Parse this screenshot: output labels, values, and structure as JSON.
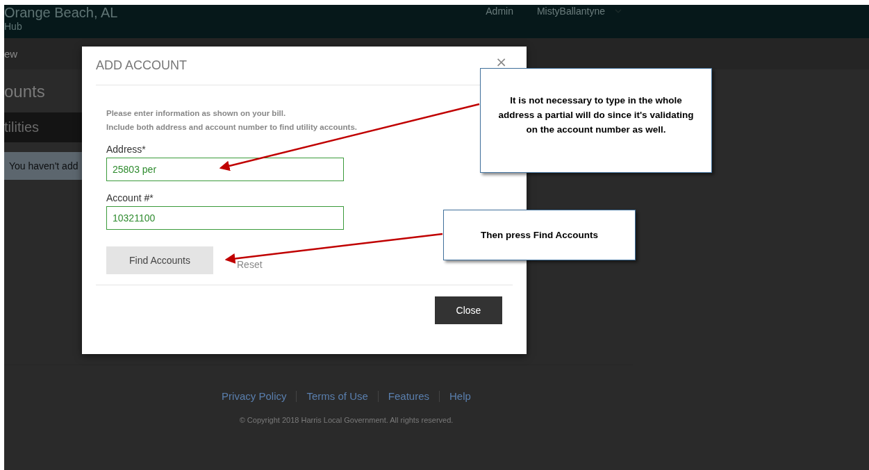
{
  "header": {
    "site_title": "Orange Beach, AL",
    "subtitle": "Hub",
    "nav": [
      "Admin",
      "MistyBallantyne"
    ]
  },
  "subnav": {
    "label": "ew"
  },
  "page": {
    "heading": "ounts",
    "section": "tilities",
    "empty_message": "You haven't add"
  },
  "footer": {
    "links": [
      "Privacy Policy",
      "Terms of Use",
      "Features",
      "Help"
    ],
    "copyright": "© Copyright 2018 Harris Local Government. All rights reserved."
  },
  "modal": {
    "title": "ADD ACCOUNT",
    "close_icon": "×",
    "info": [
      "Please enter information as shown on your bill.",
      "Include both address and account number to find utility accounts."
    ],
    "fields": [
      {
        "label": "Address*",
        "value": "25803 per"
      },
      {
        "label": "Account #*",
        "value": "10321100"
      }
    ],
    "primary_button": "Find Accounts",
    "reset_link": "Reset",
    "close_button": "Close"
  },
  "callouts": [
    {
      "text": "It is not necessary to type in the whole address a partial will do since it's validating on the account number as well."
    },
    {
      "text": "Then press Find Accounts"
    }
  ]
}
